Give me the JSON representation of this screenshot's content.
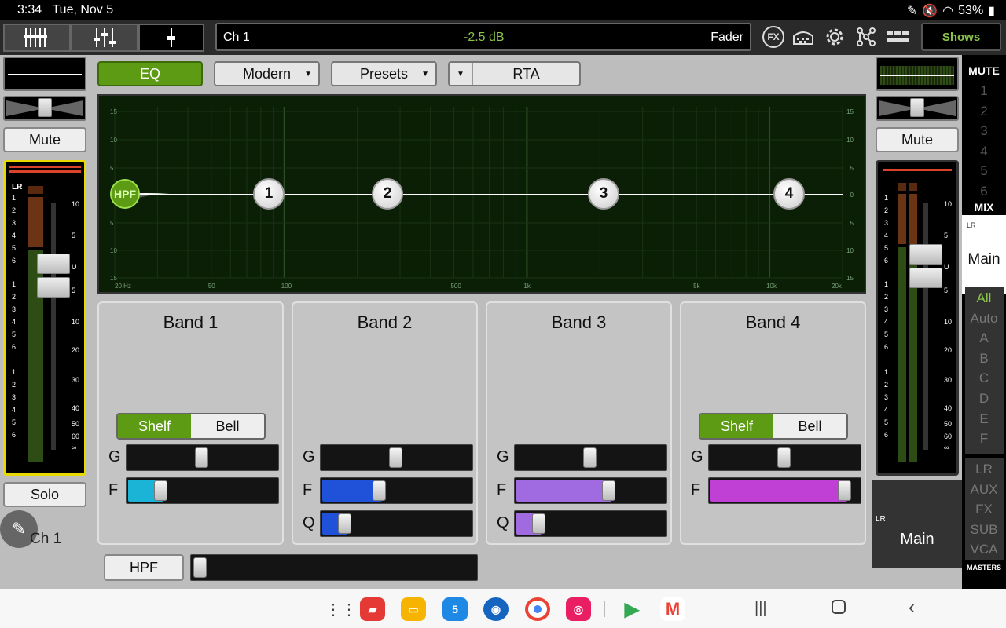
{
  "status": {
    "time": "3:34",
    "date": "Tue, Nov 5",
    "battery": "53%"
  },
  "topbar": {
    "channel": "Ch 1",
    "value": "-2.5 dB",
    "mode": "Fader",
    "fx_label": "FX",
    "shows_label": "Shows"
  },
  "left": {
    "mute": "Mute",
    "solo": "Solo",
    "name": "Ch 1",
    "bus": "LR"
  },
  "main": {
    "eq": "EQ",
    "mode": "Modern",
    "presets": "Presets",
    "rta": "RTA",
    "graph": {
      "db_labels": [
        "15",
        "10",
        "5",
        "0",
        "5",
        "10",
        "15"
      ],
      "freq_labels": [
        "20 Hz",
        "50",
        "100",
        "500",
        "1k",
        "5k",
        "10k",
        "20k"
      ],
      "hpf": "HPF",
      "nodes": [
        "1",
        "2",
        "3",
        "4"
      ]
    },
    "bands": [
      {
        "title": "Band 1",
        "shelf": "Shelf",
        "bell": "Bell",
        "g": "G",
        "f": "F",
        "q": "",
        "gain": 0.5,
        "freq": 0.2,
        "color": "#1bb3d6"
      },
      {
        "title": "Band 2",
        "g": "G",
        "f": "F",
        "q": "Q",
        "gain": 0.5,
        "freq": 0.38,
        "qv": 0.13,
        "color": "#1f52d9"
      },
      {
        "title": "Band 3",
        "g": "G",
        "f": "F",
        "q": "Q",
        "gain": 0.5,
        "freq": 0.64,
        "qv": 0.13,
        "color": "#a06ae0"
      },
      {
        "title": "Band 4",
        "shelf": "Shelf",
        "bell": "Bell",
        "g": "G",
        "f": "F",
        "q": "",
        "gain": 0.5,
        "freq": 0.95,
        "color": "#c040d6"
      }
    ],
    "hpf_button": "HPF"
  },
  "right": {
    "mute": "Mute",
    "name": "Main",
    "bus": "LR"
  },
  "mutecol": {
    "header": "MUTE",
    "groups": [
      "1",
      "2",
      "3",
      "4",
      "5",
      "6"
    ],
    "mix_header": "MIX",
    "mix_bus": "LR",
    "mix_name": "Main",
    "filters": [
      "All",
      "Auto",
      "A",
      "B",
      "C",
      "D",
      "E",
      "F"
    ],
    "masters": [
      "LR",
      "AUX",
      "FX",
      "SUB",
      "VCA"
    ],
    "masters_header": "MASTERS"
  },
  "meter_scale": [
    "10",
    "5",
    "U",
    "5",
    "10",
    "20",
    "30",
    "40",
    "50",
    "60",
    "∞"
  ],
  "meter_groups": [
    "1",
    "2",
    "3",
    "4",
    "5",
    "6"
  ],
  "nav": {
    "calendar_day": "5"
  },
  "colors": {
    "accent": "#5d9b14",
    "meter": "#e8d900",
    "shows": "#8bc34a"
  }
}
